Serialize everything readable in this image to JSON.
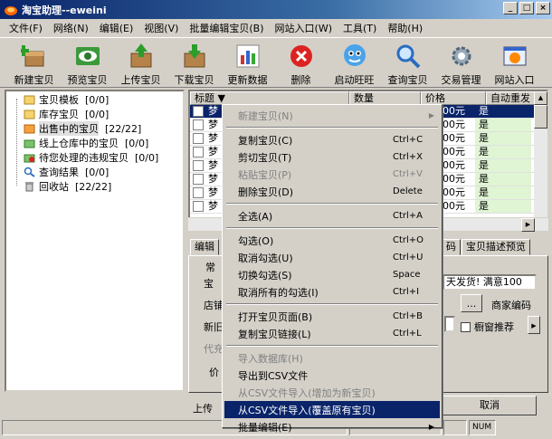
{
  "window": {
    "title": "淘宝助理--eweini"
  },
  "menubar": [
    "文件(F)",
    "网络(N)",
    "编辑(E)",
    "视图(V)",
    "批量编辑宝贝(B)",
    "网站入口(W)",
    "工具(T)",
    "帮助(H)"
  ],
  "toolbar": [
    {
      "label": "新建宝贝",
      "icon": "new-item-icon"
    },
    {
      "label": "预览宝贝",
      "icon": "preview-eye-icon"
    },
    {
      "label": "上传宝贝",
      "icon": "upload-box-icon"
    },
    {
      "label": "下载宝贝",
      "icon": "download-box-icon"
    },
    {
      "label": "更新数据",
      "icon": "update-chart-icon"
    },
    {
      "label": "删除",
      "icon": "delete-x-icon"
    },
    {
      "label": "启动旺旺",
      "icon": "wangwang-icon"
    },
    {
      "label": "查询宝贝",
      "icon": "search-magnifier-icon"
    },
    {
      "label": "交易管理",
      "icon": "trade-gear-icon"
    },
    {
      "label": "网站入口",
      "icon": "website-icon"
    }
  ],
  "tree": [
    {
      "label": "宝贝模板",
      "count": "[0/0]"
    },
    {
      "label": "库存宝贝",
      "count": "[0/0]"
    },
    {
      "label": "出售中的宝贝",
      "count": "[22/22]"
    },
    {
      "label": "线上仓库中的宝贝",
      "count": "[0/0]"
    },
    {
      "label": "待您处理的违规宝贝",
      "count": "[0/0]"
    },
    {
      "label": "查询结果",
      "count": "[0/0]"
    },
    {
      "label": "回收站",
      "count": "[22/22]"
    }
  ],
  "grid": {
    "headers": [
      "标题",
      "数量",
      "价格",
      "自动重发"
    ],
    "row_prefix": "梦",
    "rows": [
      {
        "price": "00元",
        "auto": "是"
      },
      {
        "price": "00元",
        "auto": "是"
      },
      {
        "price": "00元",
        "auto": "是"
      },
      {
        "price": "00元",
        "auto": "是"
      },
      {
        "price": "00元",
        "auto": "是"
      },
      {
        "price": "00元",
        "auto": "是"
      },
      {
        "price": "00元",
        "auto": "是"
      },
      {
        "price": "00元",
        "auto": "是"
      }
    ]
  },
  "tabs": {
    "t1": "编辑",
    "t2": "码",
    "t3": "宝贝描述预览"
  },
  "panel": {
    "group_label": "常",
    "f1": "宝",
    "f1_value": "天发货! 满意100",
    "f2": "店铺",
    "f2_btn": "...",
    "f2_label": "商家编码",
    "f3": "新旧",
    "f3_check": "橱窗推荐",
    "f4": "代充",
    "f5": "价",
    "upload_label": "上传",
    "cancel": "取消"
  },
  "status": {
    "s1": "",
    "s2": "",
    "s3": "",
    "num": "NUM"
  },
  "context_menu": [
    {
      "label": "新建宝贝(N)",
      "key": "",
      "disabled": true,
      "arrow": true
    },
    {
      "sep": true
    },
    {
      "label": "复制宝贝(C)",
      "key": "Ctrl+C"
    },
    {
      "label": "剪切宝贝(T)",
      "key": "Ctrl+X"
    },
    {
      "label": "粘贴宝贝(P)",
      "key": "Ctrl+V",
      "disabled": true
    },
    {
      "label": "删除宝贝(D)",
      "key": "Delete"
    },
    {
      "sep": true
    },
    {
      "label": "全选(A)",
      "key": "Ctrl+A"
    },
    {
      "sep": true
    },
    {
      "label": "勾选(O)",
      "key": "Ctrl+O"
    },
    {
      "label": "取消勾选(U)",
      "key": "Ctrl+U"
    },
    {
      "label": "切换勾选(S)",
      "key": "Space"
    },
    {
      "label": "取消所有的勾选(I)",
      "key": "Ctrl+I"
    },
    {
      "sep": true
    },
    {
      "label": "打开宝贝页面(B)",
      "key": "Ctrl+B"
    },
    {
      "label": "复制宝贝链接(L)",
      "key": "Ctrl+L"
    },
    {
      "sep": true
    },
    {
      "label": "导入数据库(H)",
      "key": "",
      "disabled": true
    },
    {
      "label": "导出到CSV文件",
      "key": ""
    },
    {
      "label": "从CSV文件导入(增加为新宝贝)",
      "key": "",
      "disabled": true
    },
    {
      "label": "从CSV文件导入(覆盖原有宝贝)",
      "key": "",
      "highlight": true
    },
    {
      "label": "批量编辑(E)",
      "key": "",
      "arrow": true
    }
  ]
}
